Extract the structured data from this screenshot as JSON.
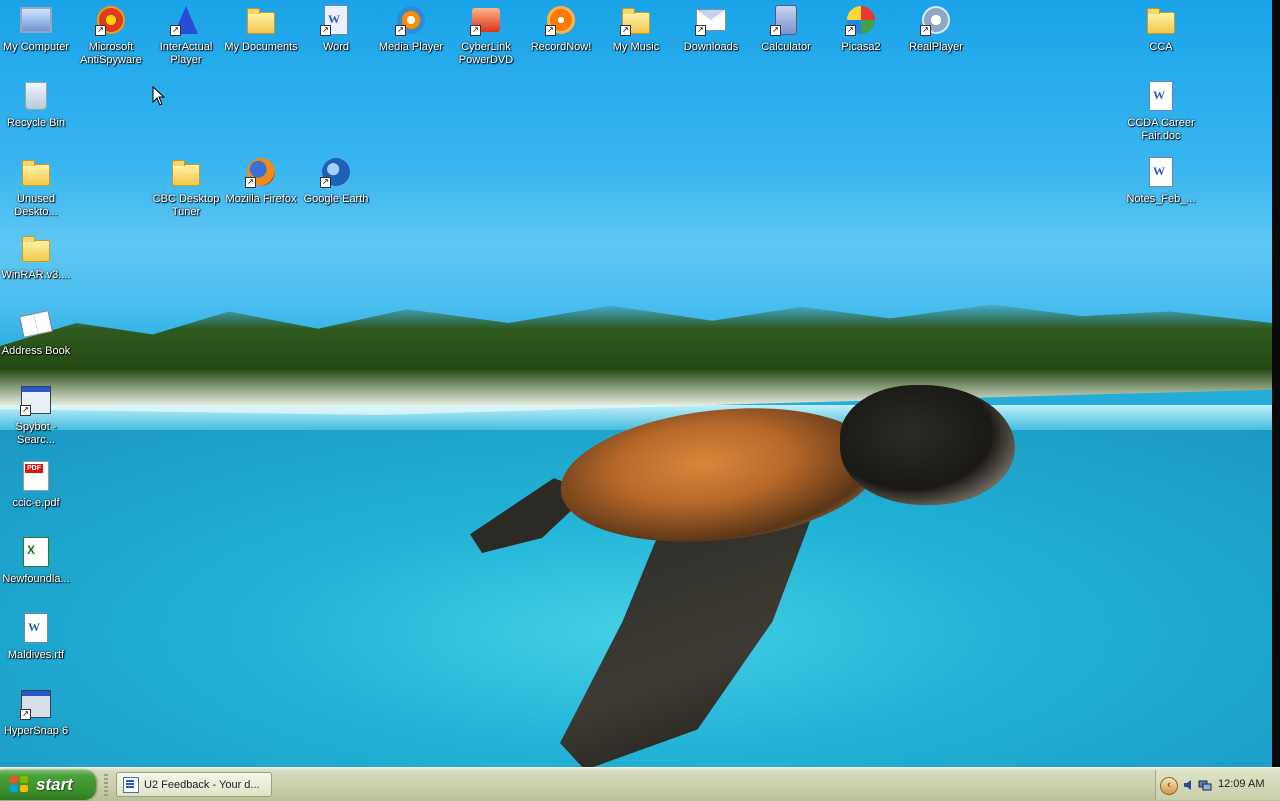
{
  "desktop": {
    "icons": {
      "my_computer": "My Computer",
      "antispyware": "Microsoft AntiSpyware",
      "interactual": "InterActual Player",
      "my_documents": "My Documents",
      "word": "Word",
      "media_player": "Media Player",
      "cyberlink": "CyberLink PowerDVD",
      "recordnow": "RecordNow!",
      "my_music": "My Music",
      "downloads": "Downloads",
      "calculator": "Calculator",
      "picasa": "Picasa2",
      "realplayer": "RealPlayer",
      "cca": "CCA",
      "recycle_bin": "Recycle Bin",
      "ccda_doc": "CCDA Career Fair.doc",
      "unused": "Unused Deskto...",
      "cbc_tuner": "CBC Desktop Tuner",
      "firefox": "Mozilla Firefox",
      "google_earth": "Google Earth",
      "notes_feb": "Notes_Feb_...",
      "winrar": "WinRAR.v3....",
      "address_book": "Address Book",
      "spybot": "Spybot - Searc...",
      "ccic_pdf": "ccic-e.pdf",
      "newfoundland": "Newfoundla...",
      "maldives": "Maldives.rtf",
      "hypersnap": "HyperSnap 6"
    },
    "icon_glyphs": {
      "pdf": "PDF",
      "word_letter": "W",
      "excel_letter": "X",
      "shortcut_arrow": "↗"
    }
  },
  "taskbar": {
    "start_label": "start",
    "task_label": "U2 Feedback - Your d...",
    "tray_arrow": "‹",
    "clock": "12:09 AM"
  },
  "colors": {
    "sky": "#1aa3e8",
    "sea": "#22b3d6",
    "start_green": "#3b8f2c",
    "taskbar": "#c9d0ac"
  }
}
